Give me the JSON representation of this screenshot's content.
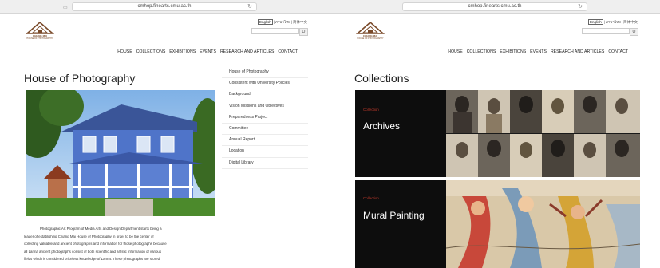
{
  "browser": {
    "url": "cmhop.finearts.cmu.ac.th"
  },
  "site": {
    "logo_line1": "CHIANG MAI",
    "logo_line2": "HOUSE OF PHOTOGRAPHY",
    "languages": [
      "English",
      "ภาษาไทย",
      "简体中文"
    ],
    "search_button": "Q",
    "nav": [
      "HOUSE",
      "COLLECTIONS",
      "EXHIBITIONS",
      "EVENTS",
      "RESEARCH AND ARTICLES",
      "CONTACT"
    ]
  },
  "left_page": {
    "active_nav": "HOUSE",
    "title": "House of Photography",
    "side_menu": [
      "House of Photography",
      "Consistent with University Policies",
      "Background",
      "Vision Missions and Objectives",
      "Preparedness Project",
      "Committee",
      "Annual Report",
      "Location",
      "Digital Library"
    ],
    "body_lines": [
      "Photographic Art Program of Media Arts and Design Department starts being a",
      "leader of establishing Chiang Mai House of Photography in order to be the center of",
      "collecting valuable and ancient photographs and information for those photographs because",
      "all Lanna ancient photographs consist of both scientific and artistic information of various",
      "fields which is considered priceless knowledge of Lanna.  These photographs are stored"
    ]
  },
  "right_page": {
    "active_nav": "COLLECTIONS",
    "title": "Collections",
    "collections": [
      {
        "label": "Collection",
        "name": "Archives"
      },
      {
        "label": "Collection",
        "name": "Mural Painting"
      }
    ]
  },
  "colors": {
    "accent_red": "#c0392b",
    "nav_rule": "#222222",
    "house_blue": "#4f74c9"
  }
}
